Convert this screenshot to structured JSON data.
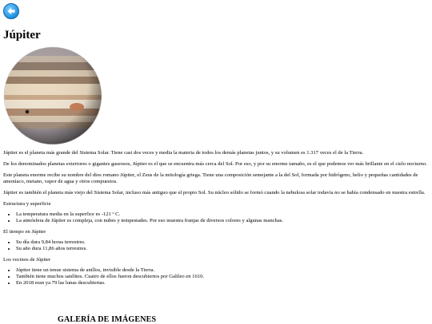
{
  "title": "Júpiter",
  "intro": "Júpiter es el planeta más grande del Sistema Solar. Tiene casi dos veces y media la materia de todos los demás planetas juntos, y su volumen es 1.317 veces el de la Tierra.",
  "paragraphs": [
    "De los denominados planetas exteriores o gigantes gaseosos, Júpiter es el que se encuentra más cerca del Sol. Por eso, y por su enorme tamaño, es el que podemos ver más brillante en el cielo nocturno.",
    "Este planeta enorme recibe su nombre del dios romano Júpiter, el Zeus de la mitología griega. Tiene una composición semejante a la del Sol, formada por hidrógeno, helio y pequeñas cantidades de amoníaco, metano, vapor de agua y otros compuestos.",
    "Júpiter es también el planeta más viejo del Sistema Solar, incluso más antiguo que el propio Sol. Su núcleo sólido se formó cuando la nebulosa solar todavía no se había condensado en nuestra estrella."
  ],
  "sections": [
    {
      "heading": "Estructura y superficie",
      "items": [
        "La temperatura media en la superfice es -121 º C.",
        "La atmósfera de Júpiter es compleja, con nubes y tempestades. Por eso muestra franjas de diversos colores y algunas manchas."
      ]
    },
    {
      "heading": "El tiempo en Júpiter",
      "items": [
        "Su día dura 9,84 horas terrestres.",
        "Su año dura 11,86 años terrestres."
      ]
    },
    {
      "heading": "Los vecinos de Júpiter",
      "items": [
        "Júpiter tiene un tenue sistema de anillos, invisible desde la Tierra.",
        "También tiene muchos satélites. Cuatro de ellos fueron descubiertos por Galileo en 1610.",
        "En 2018 eran ya 79 las lunas descubiertas."
      ]
    }
  ],
  "gallery_title": "GALERÍA DE IMÁGENES",
  "icons": {
    "back": "back-arrow-icon"
  },
  "colors": {
    "back_button": "#1d8fe0"
  }
}
